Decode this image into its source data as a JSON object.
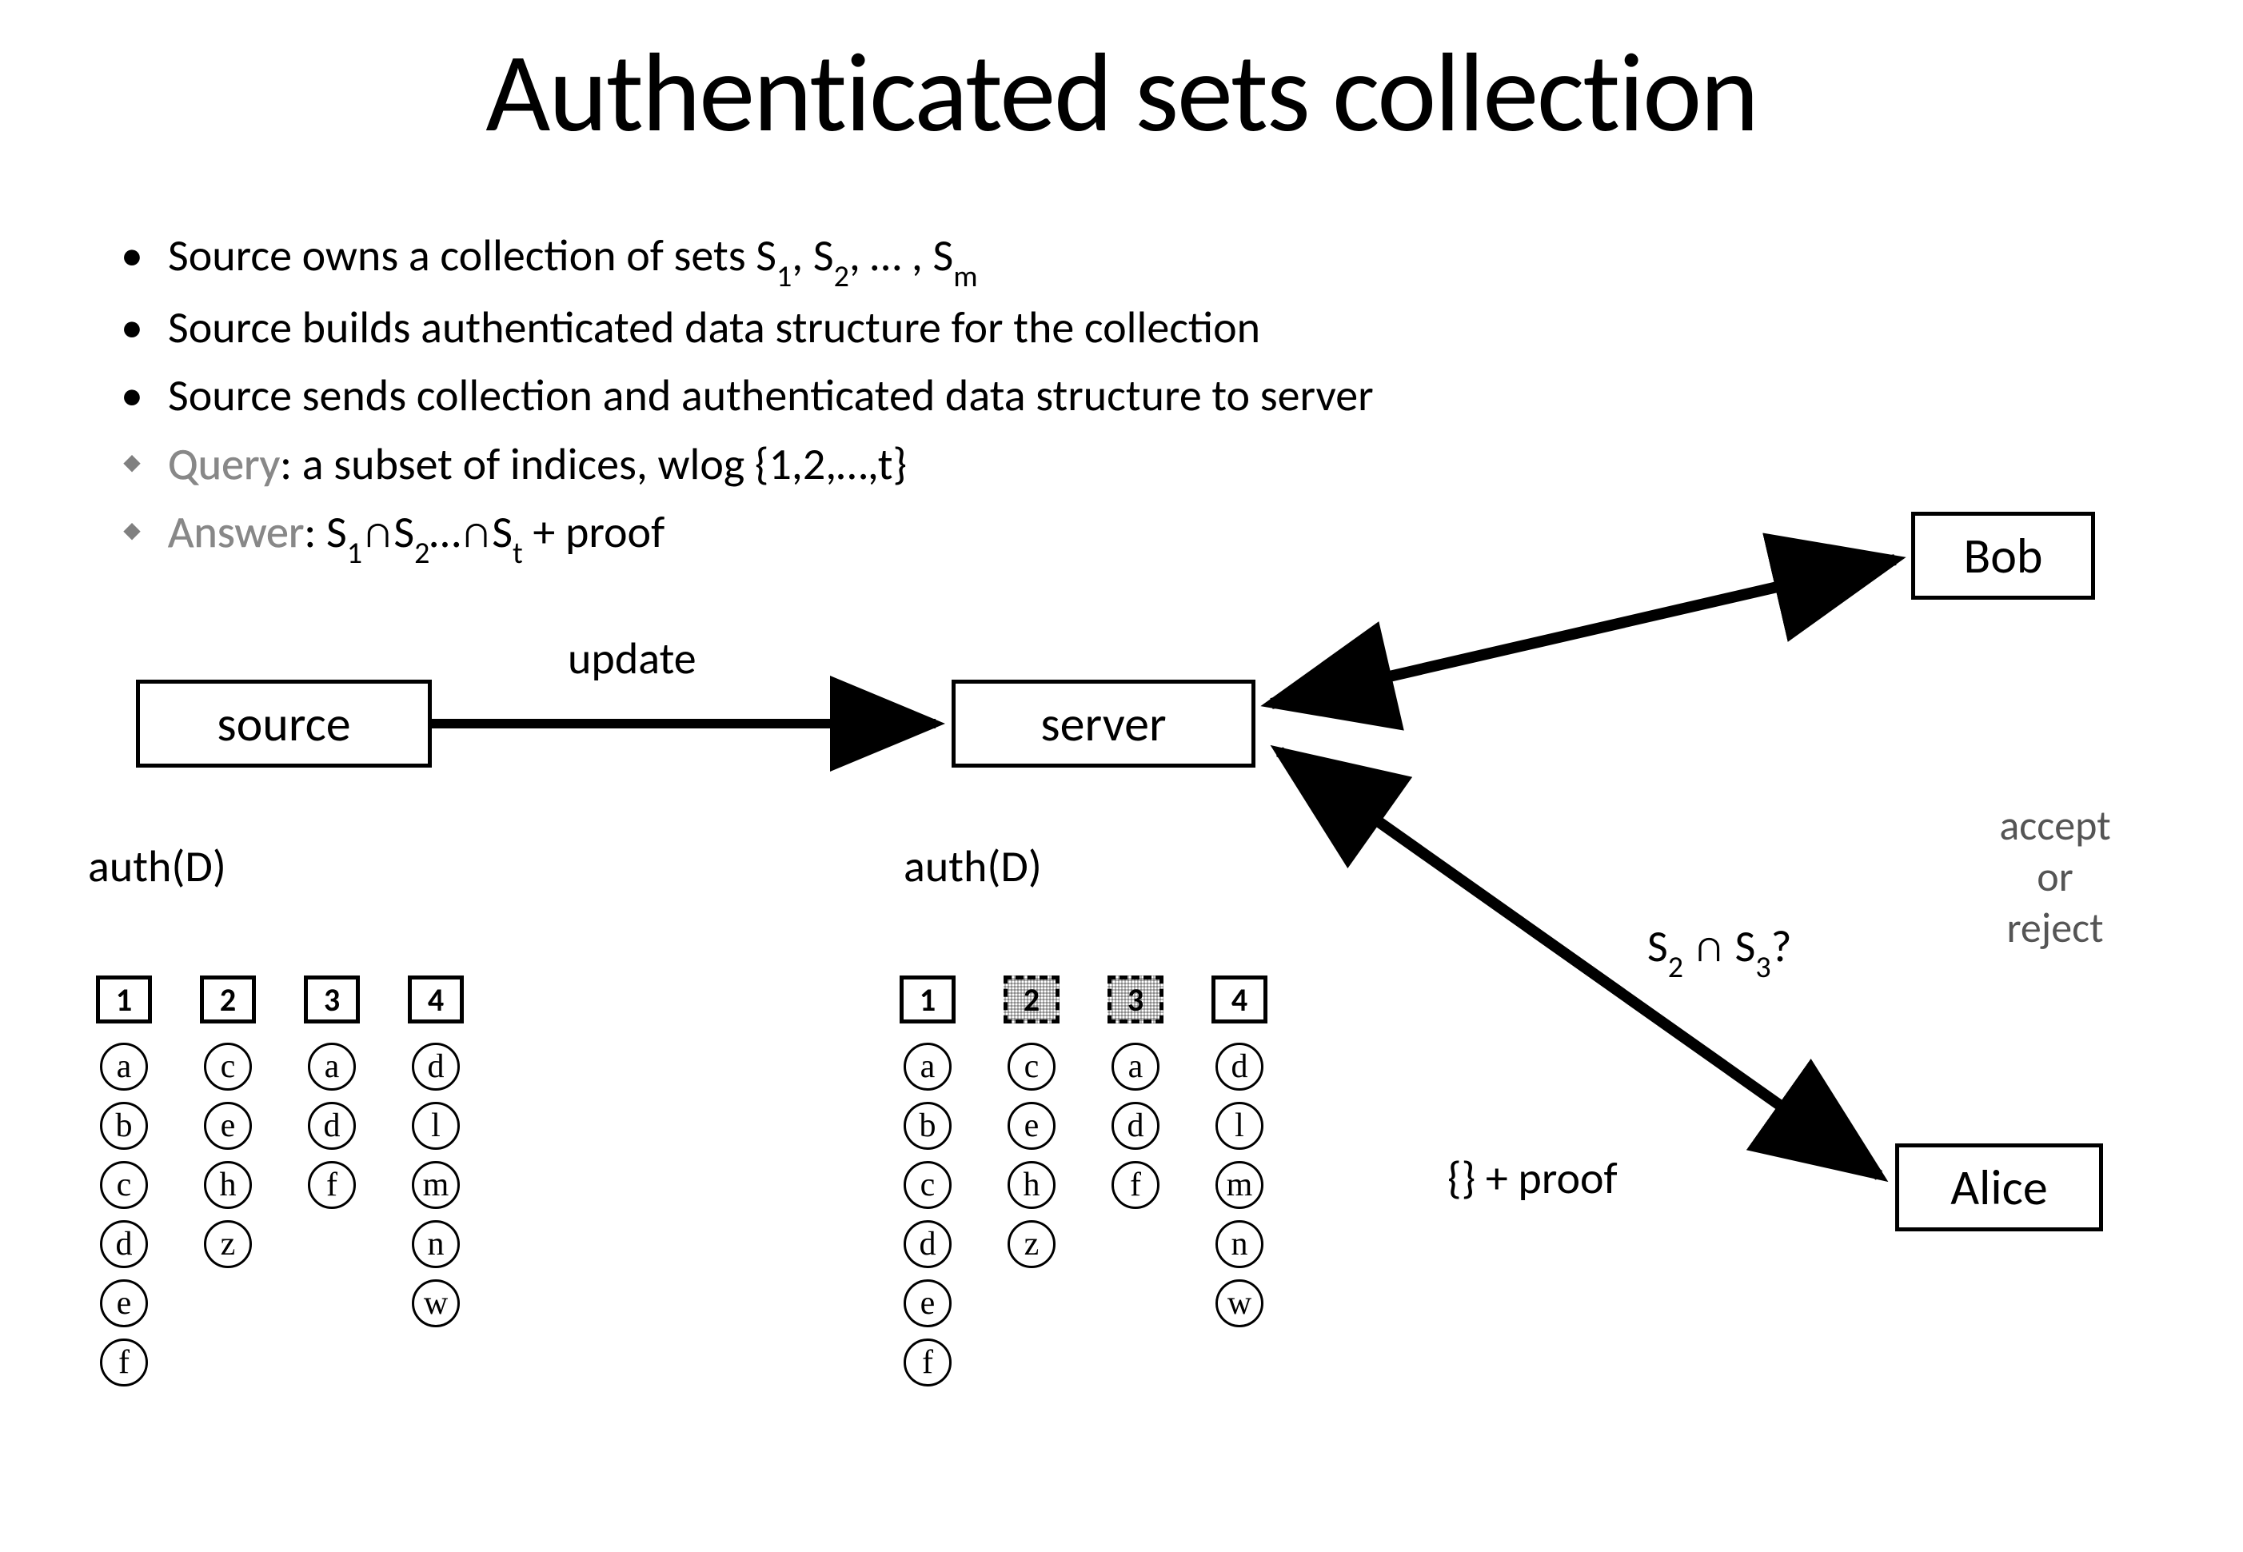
{
  "title": "Authenticated sets collection",
  "bullets": {
    "b1": "Source owns a collection of sets S",
    "b1_tail": ", S",
    "b1_tail2": ", … , S",
    "b2": "Source builds authenticated data structure for the collection",
    "b3": "Source sends collection and authenticated data structure to server",
    "b4_head": "Query",
    "b4_rest": ": a subset of indices, wlog {1,2,…,t}",
    "b5_head": "Answer",
    "b5_rest_a": ": S",
    "b5_rest_b": "∩S",
    "b5_rest_c": "…∩S",
    "b5_tail": " + proof"
  },
  "subs": {
    "one": "1",
    "two": "2",
    "m": "m",
    "t": "t",
    "three": "3"
  },
  "labels": {
    "update": "update",
    "authD_left": "auth(D)",
    "authD_right": "auth(D)",
    "query": "S",
    "query_mid": " ∩ S",
    "query_q": "?",
    "answer": "{} + proof",
    "accept": "accept",
    "or": "or",
    "reject": "reject"
  },
  "boxes": {
    "source": "source",
    "server": "server",
    "bob": "Bob",
    "alice": "Alice"
  },
  "sets_left": [
    {
      "id": "1",
      "elems": [
        "a",
        "b",
        "c",
        "d",
        "e",
        "f"
      ]
    },
    {
      "id": "2",
      "elems": [
        "c",
        "e",
        "h",
        "z"
      ]
    },
    {
      "id": "3",
      "elems": [
        "a",
        "d",
        "f"
      ]
    },
    {
      "id": "4",
      "elems": [
        "d",
        "l",
        "m",
        "n",
        "w"
      ]
    }
  ],
  "sets_right": [
    {
      "id": "1",
      "elems": [
        "a",
        "b",
        "c",
        "d",
        "e",
        "f"
      ],
      "hl": false
    },
    {
      "id": "2",
      "elems": [
        "c",
        "e",
        "h",
        "z"
      ],
      "hl": true
    },
    {
      "id": "3",
      "elems": [
        "a",
        "d",
        "f"
      ],
      "hl": true
    },
    {
      "id": "4",
      "elems": [
        "d",
        "l",
        "m",
        "n",
        "w"
      ],
      "hl": false
    }
  ]
}
